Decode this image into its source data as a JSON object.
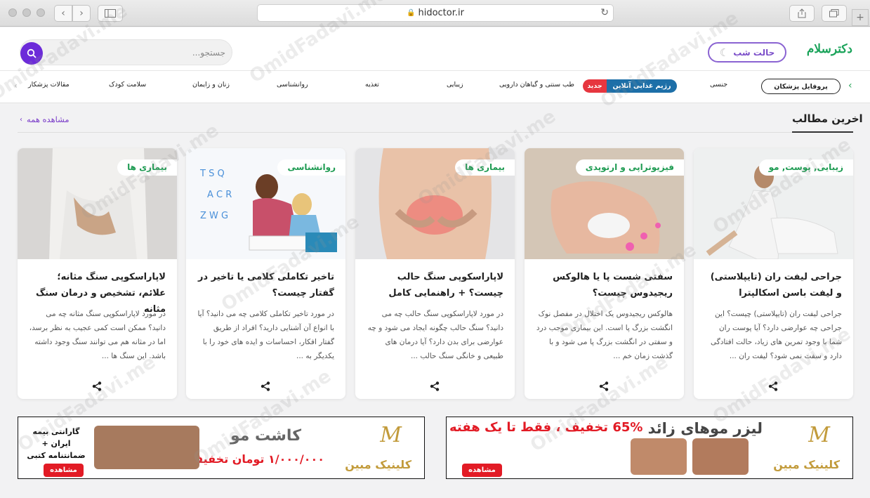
{
  "browser": {
    "url": "hidoctor.ir"
  },
  "header": {
    "logo_text": "دکترسلام",
    "night_mode_label": "حالت شب",
    "search_placeholder": "جستجو..."
  },
  "nav": {
    "profile_label": "پروفایل پزشکان",
    "items": [
      "جنسی",
      "رژیم غذایی آنلاین",
      "جدید",
      "طب سنتی و گیاهان دارویی",
      "زیبایی",
      "تغذیه",
      "روانشناسی",
      "زنان و زایمان",
      "سلامت کودک",
      "مقالات پزشکار"
    ]
  },
  "section": {
    "title": "اخرین مطالب",
    "see_all": "مشاهده همه"
  },
  "cards": [
    {
      "badge": "زیبایی, پوست, مو",
      "title": "جراحی لیفت ران (تایپلاستی) و لیفت باسن اسکالپترا",
      "desc": "جراحی لیفت ران (تایپلاستی) چیست؟ این جراحی چه عوارضی دارد؟ آیا پوست ران شما با وجود تمرین های زیاد، حالت افتادگی دارد و سفت نمی شود؟ لیفت ران ..."
    },
    {
      "badge": "فیزیوتراپی و ارتوپدی",
      "title": "سفتی شست پا یا هالوکس ریجیدوس چیست؟",
      "desc": "هالوکس ریجیدوس  یک اختلال در مفصل نوک انگشت بزرگ پا است. این بیماری موجب درد و سفتی در انگشت بزرگ پا می شود و با گذشت زمان خم ..."
    },
    {
      "badge": "بیماری ها",
      "title": "لاپاراسکوپی سنگ حالب چیست؟ + راهنمایی کامل",
      "desc": "در مورد لاپاراسکوپی سنگ حالب چه می دانید؟ سنگ حالب چگونه ایجاد می شود و چه عوارضی برای بدن دارد؟ آیا درمان های طبیعی و خانگی سنگ حالب ..."
    },
    {
      "badge": "روانشناسی",
      "title": "تاخیر تکاملی کلامی یا تاخیر در گفتار چیست؟",
      "desc": "در مورد تاخیر تکاملی کلامی چه می دانید؟ آیا با انواع آن آشنایی دارید؟ افراد از طریق گفتار افکار، احساسات و ایده های خود را با یکدیگر به ..."
    },
    {
      "badge": "بیماری ها",
      "title": "لاپاراسکوپی سنگ مثانه؛ علائم، تشخیص و درمان سنگ مثانه",
      "desc": "در مورد لاپاراسکوپی سنگ مثانه چه می دانید؟ ممکن است کمی عجیب به نظر برسد، اما در مثانه هم می توانند سنگ وجود داشته باشد. این سنگ ها ..."
    }
  ],
  "ads": [
    {
      "clinic": "کلینیک مبین",
      "heading": "لیزر موهای زائد",
      "offer": "65% تخفیف ، فقط تا یک هفته",
      "view": "مشاهده"
    },
    {
      "clinic": "کلینیک مبین",
      "heading": "کاشت مو",
      "offer": "۱/۰۰۰/۰۰۰ تومان تخفیف",
      "guarantee": "گارانتی بیمه ایران + ضمانتنامه کتبی",
      "view": "مشاهده"
    }
  ],
  "watermark": "OmidFadavi.me"
}
